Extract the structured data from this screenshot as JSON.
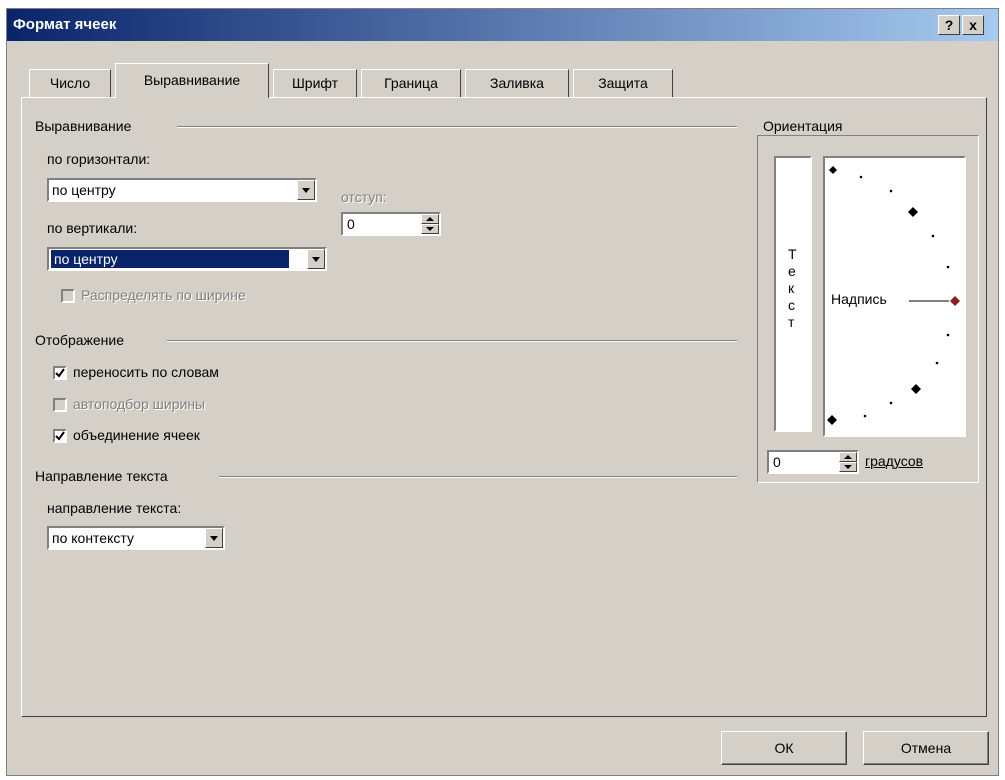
{
  "window": {
    "title": "Формат ячеек",
    "help_label": "?",
    "close_label": "x"
  },
  "tabs": [
    "Число",
    "Выравнивание",
    "Шрифт",
    "Граница",
    "Заливка",
    "Защита"
  ],
  "active_tab": "Выравнивание",
  "alignment": {
    "group_label": "Выравнивание",
    "horizontal_label": "по горизонтали:",
    "horizontal_value": "по центру",
    "indent_label": "отступ:",
    "indent_value": "0",
    "vertical_label": "по вертикали:",
    "vertical_value": "по центру",
    "distribute_label": "Распределять по ширине"
  },
  "display": {
    "group_label": "Отображение",
    "wrap_label": "переносить по словам",
    "wrap_checked": true,
    "autofit_label": "автоподбор ширины",
    "autofit_checked": false,
    "merge_label": "объединение ячеек",
    "merge_checked": true
  },
  "direction": {
    "group_label": "Направление текста",
    "dir_label": "направление текста:",
    "dir_value": "по контексту"
  },
  "orientation": {
    "group_label": "Ориентация",
    "vertical_text": [
      "Т",
      "е",
      "к",
      "с",
      "т"
    ],
    "dial_label": "Надпись",
    "degrees_value": "0",
    "degrees_label": "градусов"
  },
  "buttons": {
    "ok": "ОК",
    "cancel": "Отмена"
  }
}
